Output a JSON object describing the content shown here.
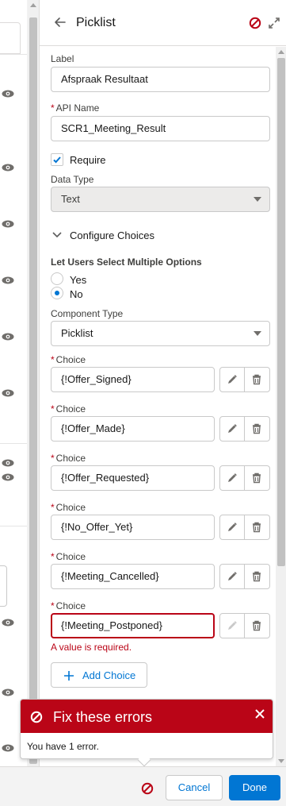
{
  "panel": {
    "title": "Picklist"
  },
  "fields": {
    "label": {
      "label": "Label",
      "value": "Afspraak Resultaat"
    },
    "api_name": {
      "required_mark": "*",
      "label": "API Name",
      "value": "SCR1_Meeting_Result"
    },
    "require": {
      "label": "Require",
      "checked": true
    },
    "data_type": {
      "label": "Data Type",
      "value": "Text"
    }
  },
  "configure_choices": {
    "section_label": "Configure Choices",
    "multi_select": {
      "label": "Let Users Select Multiple Options",
      "options": [
        {
          "label": "Yes",
          "selected": false
        },
        {
          "label": "No",
          "selected": true
        }
      ]
    },
    "component_type": {
      "label": "Component Type",
      "value": "Picklist"
    },
    "choice_label": "Choice",
    "required_mark": "*",
    "choices": [
      {
        "value": "{!Offer_Signed}"
      },
      {
        "value": "{!Offer_Made}"
      },
      {
        "value": "{!Offer_Requested}"
      },
      {
        "value": "{!No_Offer_Yet}"
      },
      {
        "value": "{!Meeting_Cancelled}"
      },
      {
        "value": "{!Meeting_Postponed}",
        "error": "A value is required."
      }
    ],
    "add_choice_label": "Add Choice"
  },
  "error_popover": {
    "title": "Fix these errors",
    "message": "You have 1 error."
  },
  "footer": {
    "cancel_label": "Cancel",
    "done_label": "Done"
  },
  "colors": {
    "brand": "#0176d3",
    "error": "#ba0517"
  }
}
